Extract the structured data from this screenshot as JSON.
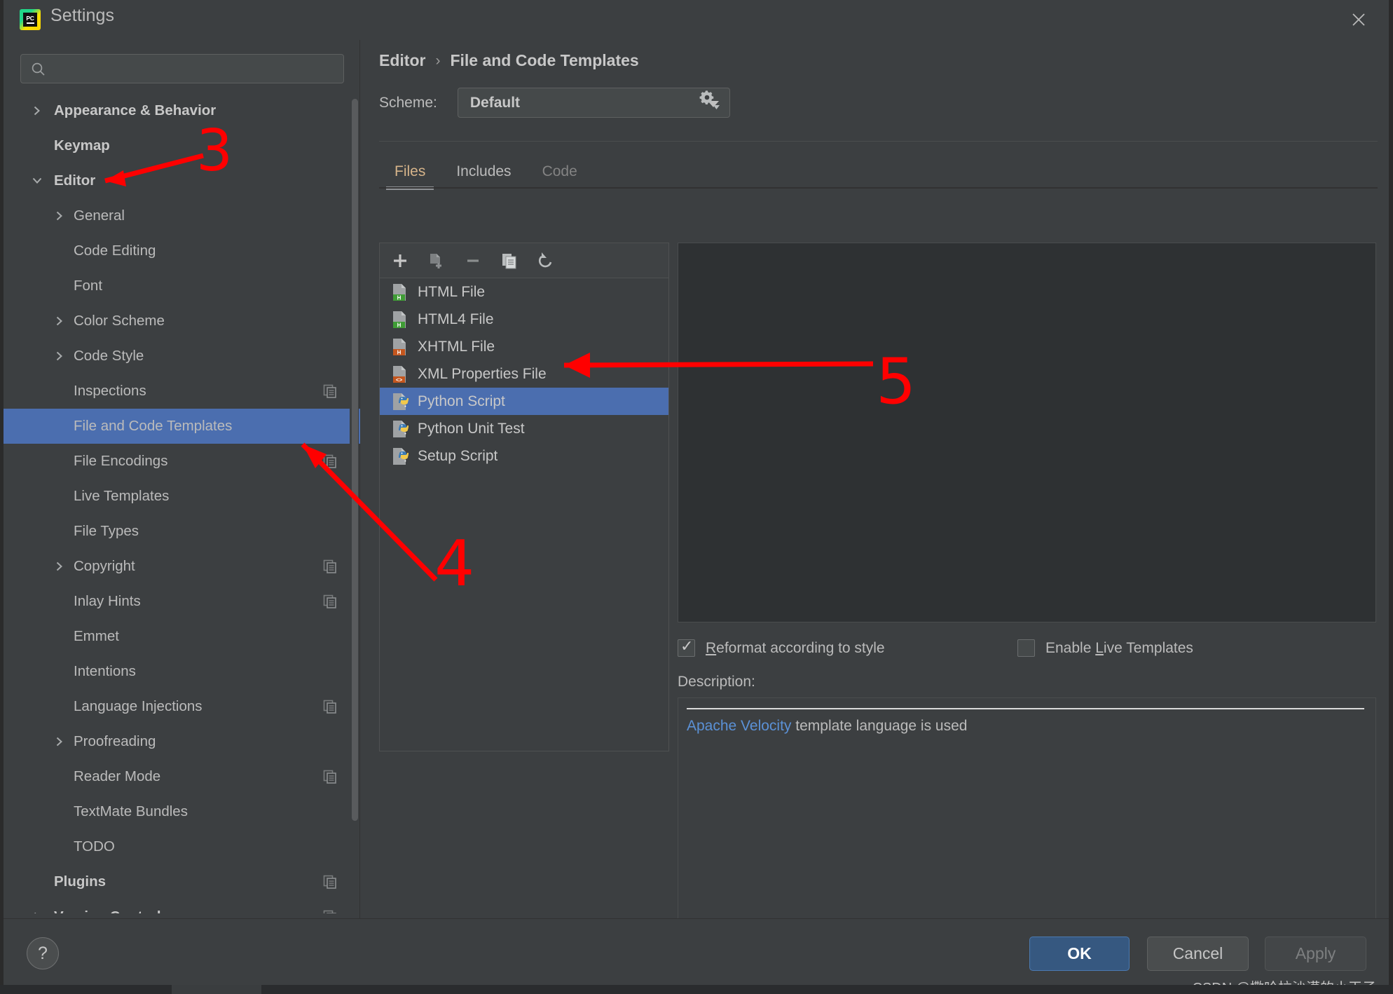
{
  "window": {
    "title": "Settings",
    "logo_text": "PC",
    "close_icon": "close-icon"
  },
  "search": {
    "value": "",
    "placeholder": ""
  },
  "sidebar": {
    "items": [
      {
        "label": "Appearance & Behavior",
        "level": 0,
        "arrow": "chevron-right",
        "bold": true,
        "selected": false,
        "copy": false
      },
      {
        "label": "Keymap",
        "level": 0,
        "arrow": "",
        "bold": true,
        "selected": false,
        "copy": false
      },
      {
        "label": "Editor",
        "level": 0,
        "arrow": "chevron-down",
        "bold": true,
        "selected": false,
        "copy": false
      },
      {
        "label": "General",
        "level": 1,
        "arrow": "chevron-right",
        "bold": false,
        "selected": false,
        "copy": false
      },
      {
        "label": "Code Editing",
        "level": 1,
        "arrow": "",
        "bold": false,
        "selected": false,
        "copy": false
      },
      {
        "label": "Font",
        "level": 1,
        "arrow": "",
        "bold": false,
        "selected": false,
        "copy": false
      },
      {
        "label": "Color Scheme",
        "level": 1,
        "arrow": "chevron-right",
        "bold": false,
        "selected": false,
        "copy": false
      },
      {
        "label": "Code Style",
        "level": 1,
        "arrow": "chevron-right",
        "bold": false,
        "selected": false,
        "copy": false
      },
      {
        "label": "Inspections",
        "level": 1,
        "arrow": "",
        "bold": false,
        "selected": false,
        "copy": true
      },
      {
        "label": "File and Code Templates",
        "level": 1,
        "arrow": "",
        "bold": false,
        "selected": true,
        "copy": false
      },
      {
        "label": "File Encodings",
        "level": 1,
        "arrow": "",
        "bold": false,
        "selected": false,
        "copy": true
      },
      {
        "label": "Live Templates",
        "level": 1,
        "arrow": "",
        "bold": false,
        "selected": false,
        "copy": false
      },
      {
        "label": "File Types",
        "level": 1,
        "arrow": "",
        "bold": false,
        "selected": false,
        "copy": false
      },
      {
        "label": "Copyright",
        "level": 1,
        "arrow": "chevron-right",
        "bold": false,
        "selected": false,
        "copy": true
      },
      {
        "label": "Inlay Hints",
        "level": 1,
        "arrow": "",
        "bold": false,
        "selected": false,
        "copy": true
      },
      {
        "label": "Emmet",
        "level": 1,
        "arrow": "",
        "bold": false,
        "selected": false,
        "copy": false
      },
      {
        "label": "Intentions",
        "level": 1,
        "arrow": "",
        "bold": false,
        "selected": false,
        "copy": false
      },
      {
        "label": "Language Injections",
        "level": 1,
        "arrow": "",
        "bold": false,
        "selected": false,
        "copy": true
      },
      {
        "label": "Proofreading",
        "level": 1,
        "arrow": "chevron-right",
        "bold": false,
        "selected": false,
        "copy": false
      },
      {
        "label": "Reader Mode",
        "level": 1,
        "arrow": "",
        "bold": false,
        "selected": false,
        "copy": true
      },
      {
        "label": "TextMate Bundles",
        "level": 1,
        "arrow": "",
        "bold": false,
        "selected": false,
        "copy": false
      },
      {
        "label": "TODO",
        "level": 1,
        "arrow": "",
        "bold": false,
        "selected": false,
        "copy": false
      },
      {
        "label": "Plugins",
        "level": 0,
        "arrow": "",
        "bold": true,
        "selected": false,
        "copy": true
      },
      {
        "label": "Version Control",
        "level": 0,
        "arrow": "chevron-right",
        "bold": true,
        "selected": false,
        "copy": true
      }
    ]
  },
  "breadcrumb": {
    "parent": "Editor",
    "separator": "›",
    "current": "File and Code Templates"
  },
  "scheme": {
    "label": "Scheme:",
    "value": "Default",
    "gear_icon": "gear-icon",
    "caret_icon": "chevron-down-icon"
  },
  "tabs": [
    {
      "label": "Files",
      "state": "active"
    },
    {
      "label": "Includes",
      "state": "normal"
    },
    {
      "label": "Code",
      "state": "disabled"
    }
  ],
  "list_toolbar": [
    {
      "icon": "plus-icon",
      "name": "add-template-button"
    },
    {
      "icon": "add-file-icon",
      "name": "create-child-template-button"
    },
    {
      "icon": "minus-icon",
      "name": "remove-template-button"
    },
    {
      "icon": "copy-icon",
      "name": "copy-template-button"
    },
    {
      "icon": "reset-icon",
      "name": "reset-template-button"
    }
  ],
  "templates": [
    {
      "label": "HTML File",
      "icon": "html-file-icon",
      "badge": "H",
      "badge_color": "#3f9c35",
      "selected": false
    },
    {
      "label": "HTML4 File",
      "icon": "html-file-icon",
      "badge": "H",
      "badge_color": "#3f9c35",
      "selected": false
    },
    {
      "label": "XHTML File",
      "icon": "xhtml-file-icon",
      "badge": "H",
      "badge_color": "#c4561e",
      "selected": false
    },
    {
      "label": "XML Properties File",
      "icon": "xml-file-icon",
      "badge": "<>",
      "badge_color": "#c4561e",
      "selected": false
    },
    {
      "label": "Python Script",
      "icon": "python-file-icon",
      "badge": "py",
      "badge_color": "#3b7ab5",
      "selected": true
    },
    {
      "label": "Python Unit Test",
      "icon": "python-file-icon",
      "badge": "py",
      "badge_color": "#3b7ab5",
      "selected": false
    },
    {
      "label": "Setup Script",
      "icon": "python-file-icon",
      "badge": "py",
      "badge_color": "#3b7ab5",
      "selected": false
    }
  ],
  "editor": {
    "content": ""
  },
  "options": {
    "reformat": {
      "label_pre": "",
      "label_underlined": "R",
      "label_post": "eformat according to style",
      "checked": true
    },
    "live_templates": {
      "label_pre": "Enable ",
      "label_underlined": "L",
      "label_post": "ive Templates",
      "checked": false
    }
  },
  "description": {
    "label": "Description:",
    "link_text": "Apache Velocity",
    "rest_text": " template language is used"
  },
  "footer": {
    "help_label": "?",
    "ok_label": "OK",
    "cancel_label": "Cancel",
    "apply_label": "Apply",
    "watermark": "CSDN @撒哈拉沙漠的小王子"
  },
  "annotations": [
    {
      "number": "3",
      "target": "Editor sidebar item"
    },
    {
      "number": "4",
      "target": "File and Code Templates sidebar item"
    },
    {
      "number": "5",
      "target": "Python Script template row"
    }
  ],
  "colors": {
    "selection_blue": "#4b6eaf",
    "annotation_red": "#ff0000",
    "accent_tab": "#d6b48a",
    "link_blue": "#5b91d6",
    "ok_button": "#365880"
  }
}
